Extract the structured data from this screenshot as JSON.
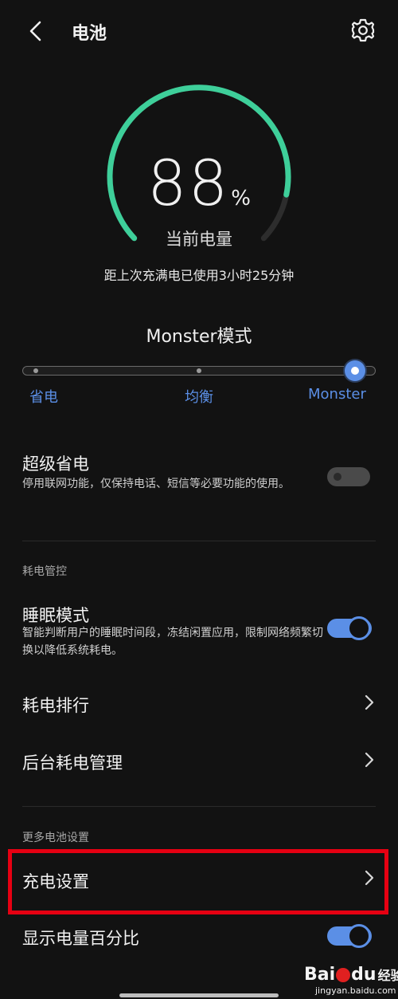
{
  "header": {
    "title": "电池",
    "back_icon": "chevron-left-icon",
    "settings_icon": "gear-icon"
  },
  "battery": {
    "percent": "88",
    "percent_sign": "%",
    "label": "当前电量",
    "level_fraction": 0.88,
    "usage": "距上次充满电已使用3小时25分钟"
  },
  "mode": {
    "title": "Monster模式",
    "options": [
      "省电",
      "均衡",
      "Monster"
    ],
    "selected": "Monster"
  },
  "super_save": {
    "title": "超级省电",
    "desc": "停用联网功能，仅保持电话、短信等必要功能的使用。",
    "enabled": false
  },
  "power_control": {
    "section_label": "耗电管控",
    "sleep_mode": {
      "title": "睡眠模式",
      "desc": "智能判断用户的睡眠时间段，冻结闲置应用，限制网络频繁切换以降低系统耗电。",
      "enabled": true
    },
    "ranking": {
      "title": "耗电排行"
    },
    "background": {
      "title": "后台耗电管理"
    }
  },
  "more_settings": {
    "section_label": "更多电池设置",
    "charging": {
      "title": "充电设置"
    },
    "show_percent": {
      "title": "显示电量百分比",
      "enabled": true
    }
  },
  "colors": {
    "accent": "#5b8fe6",
    "gauge": "#3ecf9a",
    "highlight": "#e60012",
    "background": "#121212"
  },
  "watermark": {
    "brand": "Bai",
    "brand2": "du",
    "suffix": "经验",
    "url": "jingyan.baidu.com"
  }
}
